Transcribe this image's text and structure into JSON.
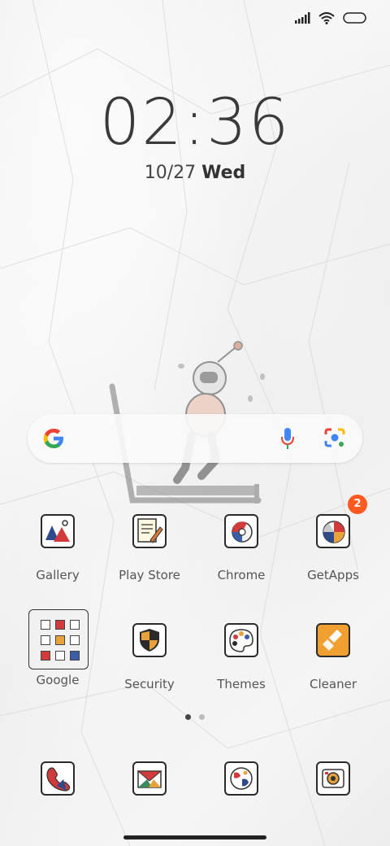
{
  "clock": {
    "time": "02:36"
  },
  "date": {
    "monthday": "10/27",
    "weekday": "Wed"
  },
  "search": {
    "brand": "google-g-icon",
    "mic": "mic-icon",
    "camera": "lens-icon"
  },
  "apps_row1": [
    {
      "label": "Gallery",
      "icon": "gallery-icon"
    },
    {
      "label": "Play Store",
      "icon": "play-store-icon"
    },
    {
      "label": "Chrome",
      "icon": "chrome-icon"
    },
    {
      "label": "GetApps",
      "icon": "getapps-icon",
      "badge": "2"
    }
  ],
  "apps_row2": [
    {
      "label": "Google",
      "icon": "google-folder-icon"
    },
    {
      "label": "Security",
      "icon": "security-icon"
    },
    {
      "label": "Themes",
      "icon": "themes-icon"
    },
    {
      "label": "Cleaner",
      "icon": "cleaner-icon"
    }
  ],
  "dock": [
    {
      "icon": "phone-icon"
    },
    {
      "icon": "messages-icon"
    },
    {
      "icon": "browser-icon"
    },
    {
      "icon": "camera-icon"
    }
  ],
  "page_indicator": {
    "count": 2,
    "active": 0
  },
  "colors": {
    "badge": "#ff5a1f",
    "cleaner": "#f0a030"
  }
}
